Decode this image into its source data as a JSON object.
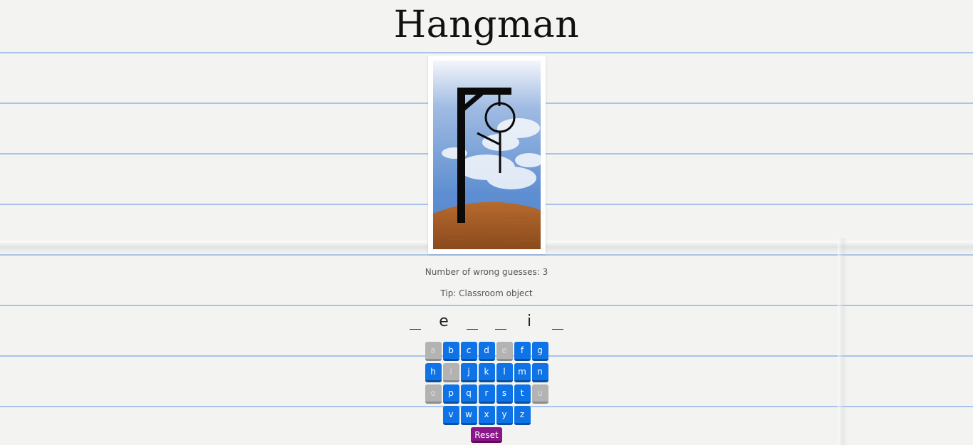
{
  "title": "Hangman",
  "status": {
    "wrong_guesses_label": "Number of wrong guesses: 3",
    "wrong_guesses": 3,
    "tip": "Tip: Classroom object"
  },
  "word": [
    {
      "letter": "",
      "revealed": false
    },
    {
      "letter": "e",
      "revealed": true
    },
    {
      "letter": "",
      "revealed": false
    },
    {
      "letter": "",
      "revealed": false
    },
    {
      "letter": "i",
      "revealed": true
    },
    {
      "letter": "",
      "revealed": false
    }
  ],
  "keyboard": {
    "rows": [
      [
        {
          "letter": "a",
          "used": true
        },
        {
          "letter": "b",
          "used": false
        },
        {
          "letter": "c",
          "used": false
        },
        {
          "letter": "d",
          "used": false
        },
        {
          "letter": "e",
          "used": true
        },
        {
          "letter": "f",
          "used": false
        },
        {
          "letter": "g",
          "used": false
        }
      ],
      [
        {
          "letter": "h",
          "used": false
        },
        {
          "letter": "i",
          "used": true
        },
        {
          "letter": "j",
          "used": false
        },
        {
          "letter": "k",
          "used": false
        },
        {
          "letter": "l",
          "used": false
        },
        {
          "letter": "m",
          "used": false
        },
        {
          "letter": "n",
          "used": false
        }
      ],
      [
        {
          "letter": "o",
          "used": true
        },
        {
          "letter": "p",
          "used": false
        },
        {
          "letter": "q",
          "used": false
        },
        {
          "letter": "r",
          "used": false
        },
        {
          "letter": "s",
          "used": false
        },
        {
          "letter": "t",
          "used": false
        },
        {
          "letter": "u",
          "used": true
        }
      ],
      [
        {
          "letter": "v",
          "used": false
        },
        {
          "letter": "w",
          "used": false
        },
        {
          "letter": "x",
          "used": false
        },
        {
          "letter": "y",
          "used": false
        },
        {
          "letter": "z",
          "used": false
        }
      ]
    ]
  },
  "reset_label": "Reset",
  "colors": {
    "key_active": "#0e73e6",
    "key_used": "#b3b3b3",
    "reset": "#8a1689"
  }
}
